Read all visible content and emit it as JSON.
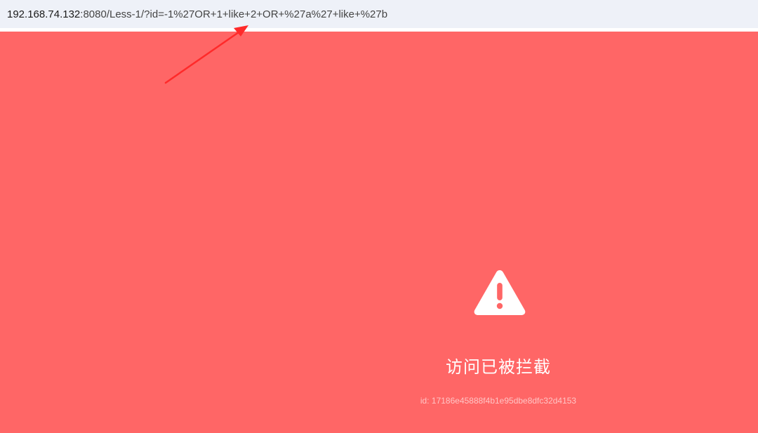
{
  "address_bar": {
    "host": "192.168.74.132",
    "path": ":8080/Less-1/?id=-1%27OR+1+like+2+OR+%27a%27+like+%27b"
  },
  "blocked_page": {
    "icon": "warning-triangle-icon",
    "title": "访问已被拦截",
    "request_id": "id: 17186e45888f4b1e95dbe8dfc32d4153",
    "background_color": "#ff6666"
  },
  "annotation": {
    "icon": "red-arrow-icon",
    "color": "#ff2a2a"
  }
}
